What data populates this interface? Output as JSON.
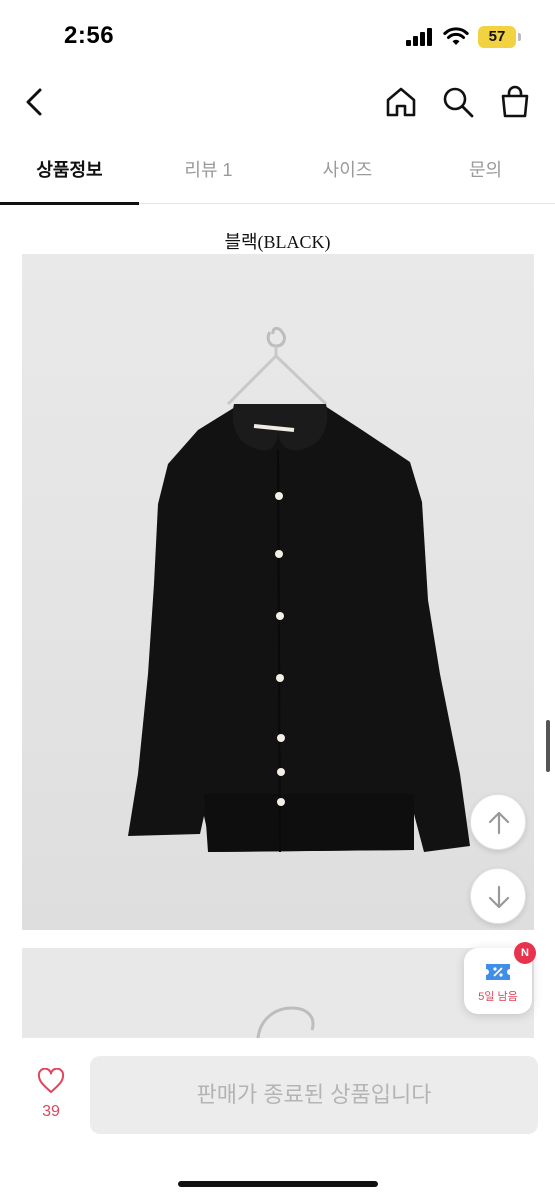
{
  "status_bar": {
    "time": "2:56",
    "battery": "57"
  },
  "header": {
    "icons": [
      "chevron-left-icon",
      "home-icon",
      "search-icon",
      "shopping-bag-icon"
    ]
  },
  "tabs": [
    {
      "label": "상품정보",
      "active": true
    },
    {
      "label": "리뷰 1",
      "active": false
    },
    {
      "label": "사이즈",
      "active": false
    },
    {
      "label": "문의",
      "active": false
    }
  ],
  "content": {
    "section_label": "블랙(BLACK)"
  },
  "floating": {
    "coupon_text": "5일 남음",
    "coupon_badge": "N"
  },
  "bottom_bar": {
    "like_count": "39",
    "sold_out_label": "판매가 종료된 상품입니다"
  },
  "colors": {
    "accent_pink": "#e0455b",
    "badge_red": "#e8334f",
    "battery_yellow": "#f3d241",
    "disabled_gray": "#ececec"
  }
}
